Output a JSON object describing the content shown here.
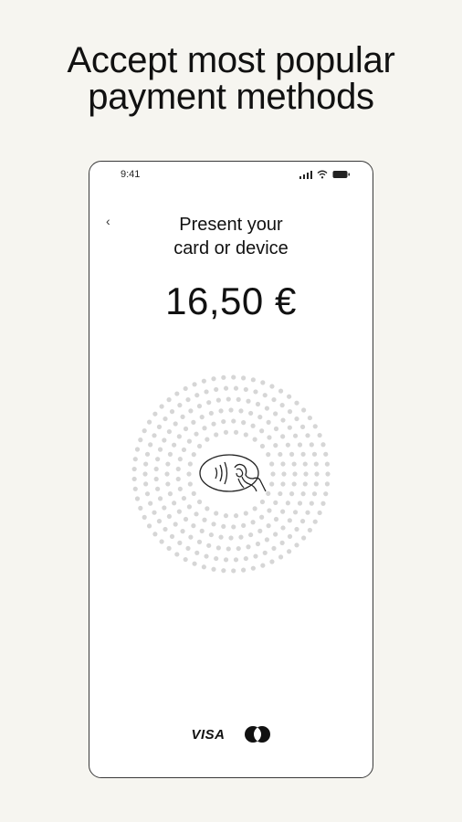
{
  "headline": {
    "line1": "Accept most popular",
    "line2": "payment methods"
  },
  "status_bar": {
    "time": "9:41",
    "icons": [
      "signal-icon",
      "wifi-icon",
      "battery-icon"
    ]
  },
  "payment": {
    "back_icon": "chevron-left-icon",
    "prompt_line1": "Present your",
    "prompt_line2": "card or device",
    "amount": "16,50 €",
    "tap_icon": "contactless-tap-icon"
  },
  "card_brands": {
    "visa_label": "VISA",
    "mastercard_icon": "mastercard-icon"
  },
  "colors": {
    "background": "#f6f5f0",
    "text": "#111111",
    "dots": "#d6d6d6"
  }
}
